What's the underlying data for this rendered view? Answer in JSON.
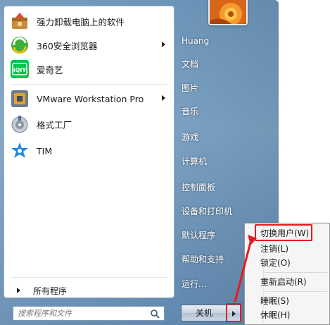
{
  "programs": [
    {
      "label": "强力卸载电脑上的软件",
      "icon": "uninstaller-icon",
      "has_submenu": false
    },
    {
      "label": "360安全浏览器",
      "icon": "360-browser-icon",
      "has_submenu": true
    },
    {
      "label": "爱奇艺",
      "icon": "iqiyi-icon",
      "icon_text": "iQIY",
      "has_submenu": false
    },
    {
      "label": "VMware Workstation Pro",
      "icon": "vmware-icon",
      "has_submenu": true
    },
    {
      "label": "格式工厂",
      "icon": "format-factory-icon",
      "has_submenu": false
    },
    {
      "label": "TIM",
      "icon": "tim-icon",
      "has_submenu": false
    }
  ],
  "all_programs_label": "所有程序",
  "search": {
    "placeholder": "搜索程序和文件"
  },
  "right_links": [
    {
      "label": "Huang"
    },
    {
      "label": "文档"
    },
    {
      "label": "图片"
    },
    {
      "label": "音乐"
    },
    {
      "label": "游戏"
    },
    {
      "label": "计算机"
    },
    {
      "label": "控制面板"
    },
    {
      "label": "设备和打印机"
    },
    {
      "label": "默认程序"
    },
    {
      "label": "帮助和支持"
    },
    {
      "label": "运行..."
    }
  ],
  "shutdown": {
    "label": "关机"
  },
  "power_submenu": [
    {
      "label": "切换用户(W)",
      "highlighted": true
    },
    {
      "label": "注销(L)"
    },
    {
      "label": "锁定(O)"
    },
    {
      "label": "重新启动(R)"
    },
    {
      "label": "睡眠(S)"
    },
    {
      "label": "休眠(H)"
    }
  ],
  "colors": {
    "accent_red": "#e11d1d",
    "frame_blue": "#6a93b8"
  }
}
